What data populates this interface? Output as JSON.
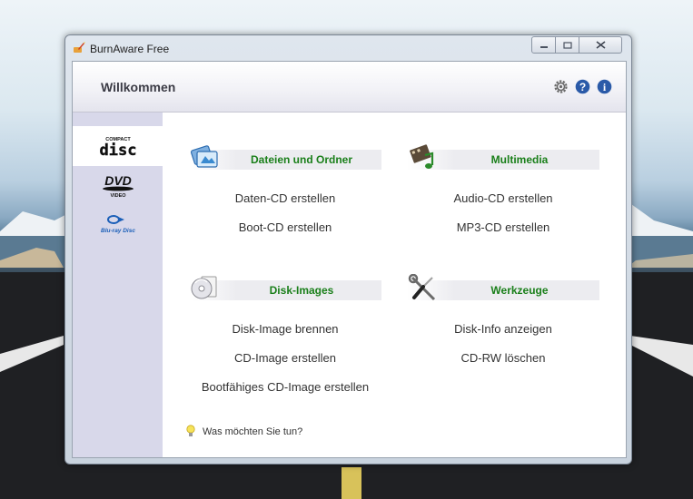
{
  "window": {
    "title": "BurnAware Free"
  },
  "header": {
    "title": "Willkommen"
  },
  "sidebar": {
    "items": [
      {
        "icon": "compact-disc-icon",
        "label": "disc",
        "sub": "COMPACT"
      },
      {
        "icon": "dvd-video-icon",
        "label": "DVD",
        "sub": "VIDEO"
      },
      {
        "icon": "bluray-disc-icon",
        "label": "Blu-ray Disc"
      }
    ]
  },
  "sections": {
    "data": {
      "title": "Dateien und Ordner",
      "icon": "files-folders-icon",
      "links": [
        "Daten-CD erstellen",
        "Boot-CD erstellen"
      ]
    },
    "multimedia": {
      "title": "Multimedia",
      "icon": "film-music-icon",
      "links": [
        "Audio-CD erstellen",
        "MP3-CD erstellen"
      ]
    },
    "images": {
      "title": "Disk-Images",
      "icon": "disc-image-icon",
      "links": [
        "Disk-Image brennen",
        "CD-Image erstellen",
        "Bootfähiges CD-Image erstellen"
      ]
    },
    "tools": {
      "title": "Werkzeuge",
      "icon": "wrench-screwdriver-icon",
      "links": [
        "Disk-Info anzeigen",
        "CD-RW löschen"
      ]
    }
  },
  "tip": {
    "text": "Was möchten Sie tun?",
    "icon": "lightbulb-icon"
  },
  "colors": {
    "section_title": "#1a7f1a",
    "sidebar_bg": "#d8d8ea",
    "info_blue": "#2a5aa8"
  }
}
